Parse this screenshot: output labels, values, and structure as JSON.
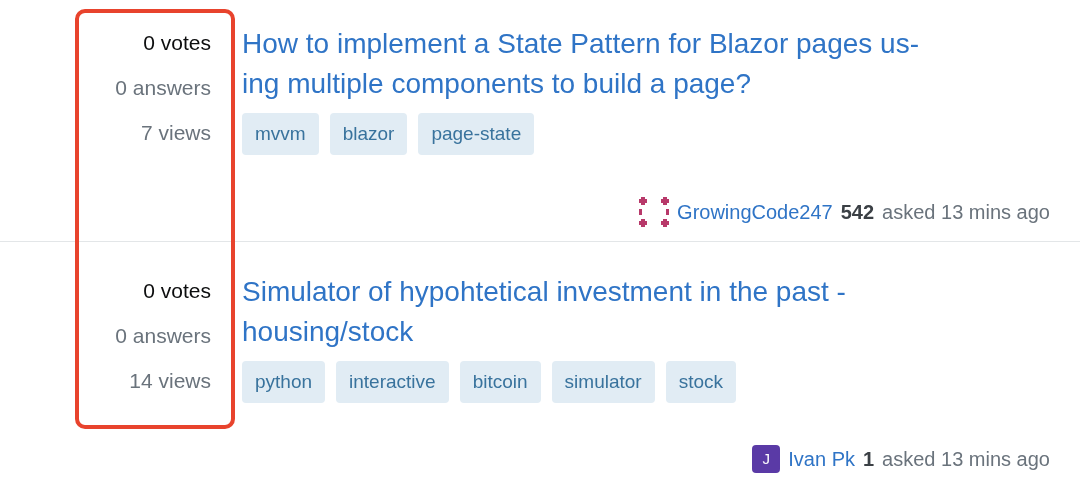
{
  "questions": [
    {
      "votes": "0 votes",
      "answers": "0 answers",
      "views": "7 views",
      "title_lines": [
        "How to implement a State Pattern for Blazor pages us-",
        "ing multiple components to build a page?"
      ],
      "tags": [
        "mvvm",
        "blazor",
        "page-state"
      ],
      "author": {
        "avatar": {
          "kind": "identicon",
          "color": "#b8396a"
        },
        "name": "GrowingCode247",
        "reputation": "542",
        "asked": "asked 13 mins ago"
      }
    },
    {
      "votes": "0 votes",
      "answers": "0 answers",
      "views": "14 views",
      "title_lines": [
        "Simulator of hypohtetical investment in the past -",
        "housing/stock"
      ],
      "tags": [
        "python",
        "interactive",
        "bitcoin",
        "simulator",
        "stock"
      ],
      "author": {
        "avatar": {
          "kind": "letter",
          "letter": "J",
          "color": "#5a3aa6"
        },
        "name": "Ivan Pk",
        "reputation": "1",
        "asked": "asked 13 mins ago"
      }
    }
  ]
}
